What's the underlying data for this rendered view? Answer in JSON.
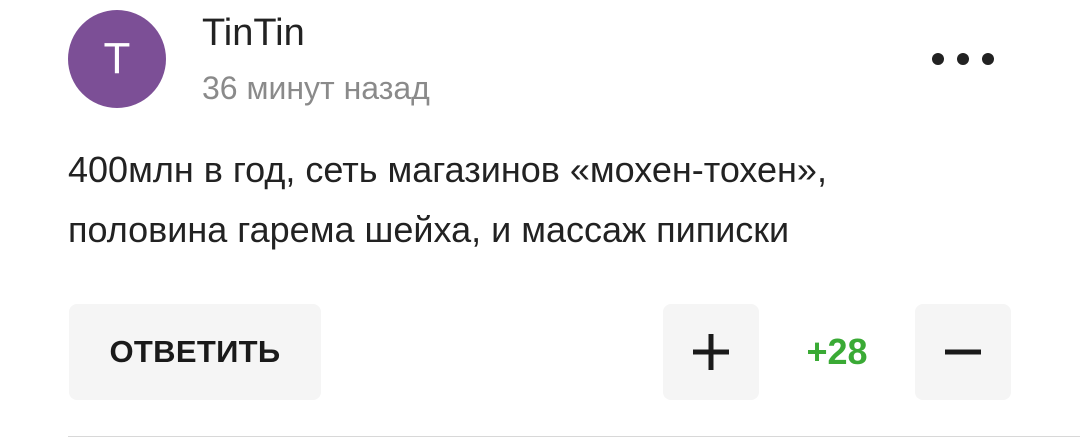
{
  "comment": {
    "avatar_letter": "T",
    "author": "TinTin",
    "time": "36 минут назад",
    "text_line1": "400млн в год, сеть магазинов «мохен-тохен»,",
    "text_line2": "половина гарема шейха, и массаж пиписки"
  },
  "actions": {
    "reply_label": "ОТВЕТИТЬ",
    "score": "+28"
  },
  "colors": {
    "avatar": "#7c4f96",
    "score": "#3aaa35",
    "button_bg": "#f5f5f5"
  }
}
